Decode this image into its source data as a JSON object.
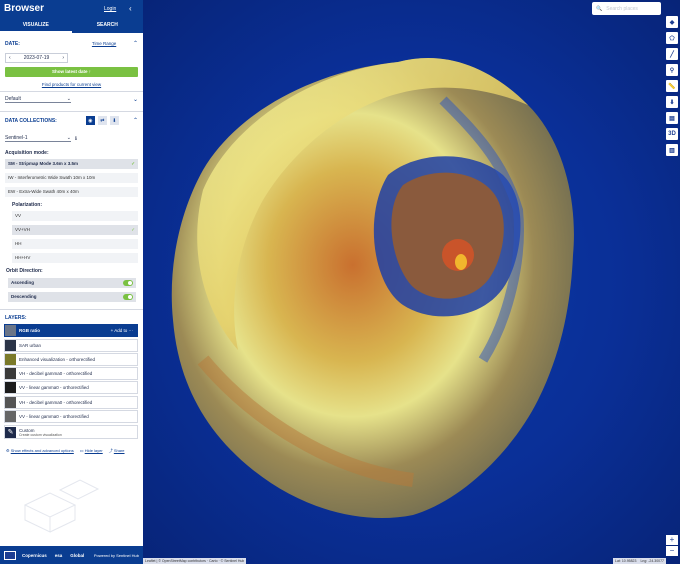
{
  "header": {
    "brand": "Browser",
    "login": "Login",
    "tabs": [
      "VISUALIZE",
      "SEARCH"
    ]
  },
  "date": {
    "section_label": "DATE:",
    "time_range": "Time Range",
    "value": "2023-07-19",
    "show_latest": "Show latest date",
    "find_products": "Find products for current view"
  },
  "theme": {
    "selected": "Default"
  },
  "collections": {
    "section_label": "DATA COLLECTIONS:",
    "selected": "Sentinel-1",
    "acquisition_label": "Acquisition mode:",
    "modes": [
      "SM - Stripmap Mode 3.6m x 3.5m",
      "IW - Interferometric Wide Swath 10m x 10m",
      "EW - Extra-Wide Swath 40m x 40m"
    ],
    "polarization_label": "Polarization:",
    "polarizations": [
      "VV",
      "VV+VH",
      "HH",
      "HH+HV"
    ],
    "orbit_label": "Orbit Direction:",
    "orbits": [
      "Ascending",
      "Descending"
    ]
  },
  "layers": {
    "section_label": "LAYERS:",
    "add_to": "Add to",
    "items": [
      {
        "label": "RGB ratio",
        "sub": "",
        "color": "#6a7588"
      },
      {
        "label": "SAR urban",
        "sub": "",
        "color": "#2b3447"
      },
      {
        "label": "Enhanced visualization - orthorectified",
        "sub": "",
        "color": "#7b7a2a"
      },
      {
        "label": "VH - decibel gamma0 - orthorectified",
        "sub": "",
        "color": "#3a3a3a"
      },
      {
        "label": "VV - linear gamma0 - orthorectified",
        "sub": "",
        "color": "#4a4a4a"
      },
      {
        "label": "VH - decibel gamma0 - orthorectified",
        "sub": "",
        "color": "#555555"
      },
      {
        "label": "VV - linear gamma0 - orthorectified",
        "sub": "",
        "color": "#666666"
      },
      {
        "label": "Custom",
        "sub": "Create custom visualization",
        "color": "#1e2a4a"
      }
    ]
  },
  "bottom_links": {
    "effects": "Show effects and advanced options",
    "hide": "Hide layer",
    "share": "Share"
  },
  "footer": {
    "logo1": "Copernicus",
    "logo2": "esa",
    "logo3": "Global",
    "powered": "Powered by Sentinel Hub"
  },
  "map": {
    "search_placeholder": "Search places",
    "attribution": "Leaflet | © OpenStreetMap contributors · Carto · © Sentinel Hub",
    "lat": "Lat: 10.95823",
    "lng": "Lng: -24.30077",
    "scale": "5 km"
  }
}
